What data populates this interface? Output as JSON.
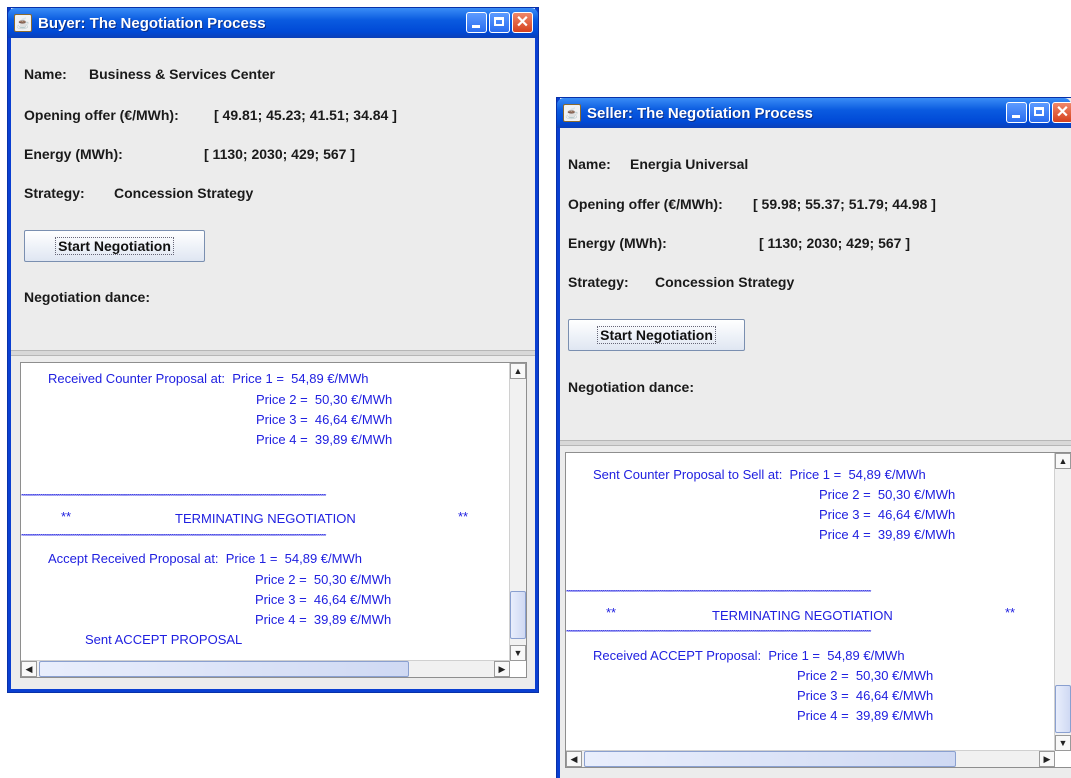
{
  "buyer": {
    "window_title": "Buyer: The Negotiation Process",
    "name_label": "Name:",
    "name_value": "Business & Services Center",
    "offer_label": "Opening offer (€/MWh):",
    "offer_value": "[ 49.81; 45.23; 41.51; 34.84 ]",
    "energy_label": "Energy (MWh):",
    "energy_value": "[ 1130; 2030; 429; 567 ]",
    "strategy_label": "Strategy:",
    "strategy_value": "Concession Strategy",
    "start_button": "Start Negotiation",
    "dance_label": "Negotiation dance:",
    "log": {
      "line1": "Received Counter Proposal at:  Price 1 =  54,89 €/MWh",
      "line2": "Price 2 =  50,30 €/MWh",
      "line3": "Price 3 =  46,64 €/MWh",
      "line4": "Price 4 =  39,89 €/MWh",
      "stars": "************************************************************************************************************************************************",
      "term_left": "**",
      "term_text": "TERMINATING NEGOTIATION",
      "term_right": "**",
      "line5": "Accept Received Proposal at:  Price 1 =  54,89 €/MWh",
      "line6": "Price 2 =  50,30 €/MWh",
      "line7": "Price 3 =  46,64 €/MWh",
      "line8": "Price 4 =  39,89 €/MWh",
      "line9": "Sent ACCEPT PROPOSAL"
    }
  },
  "seller": {
    "window_title": "Seller: The Negotiation Process",
    "name_label": "Name:",
    "name_value": "Energia Universal",
    "offer_label": "Opening offer (€/MWh):",
    "offer_value": "[ 59.98; 55.37; 51.79; 44.98 ]",
    "energy_label": "Energy (MWh):",
    "energy_value": "[ 1130; 2030; 429; 567 ]",
    "strategy_label": "Strategy:",
    "strategy_value": "Concession Strategy",
    "start_button": "Start Negotiation",
    "dance_label": "Negotiation dance:",
    "log": {
      "line1": "Sent Counter Proposal to Sell at:  Price 1 =  54,89 €/MWh",
      "line2": "Price 2 =  50,30 €/MWh",
      "line3": "Price 3 =  46,64 €/MWh",
      "line4": "Price 4 =  39,89 €/MWh",
      "stars": "************************************************************************************************************************************************",
      "term_left": "**",
      "term_text": "TERMINATING NEGOTIATION",
      "term_right": "**",
      "line5": "Received ACCEPT Proposal:  Price 1 =  54,89 €/MWh",
      "line6": "Price 2 =  50,30 €/MWh",
      "line7": "Price 3 =  46,64 €/MWh",
      "line8": "Price 4 =  39,89 €/MWh"
    }
  }
}
